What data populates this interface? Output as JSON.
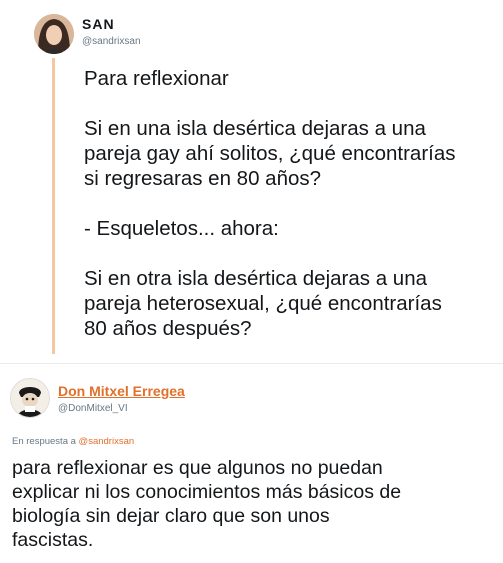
{
  "tweet": {
    "display_name": "SAN",
    "handle": "@sandrixsan",
    "lines": [
      "Para reflexionar",
      "",
      "Si en una isla desértica dejaras a una",
      "pareja gay ahí solitos, ¿qué encontrarías",
      "si regresaras en 80 años?",
      "",
      "- Esqueletos... ahora:",
      "",
      "Si en otra isla desértica dejaras a una",
      "pareja heterosexual, ¿qué encontrarías",
      "80 años después?"
    ]
  },
  "reply": {
    "display_name": "Don Mitxel Erregea",
    "handle": "@DonMitxel_VI",
    "reply_prefix": "En respuesta a",
    "reply_to_handle": "@sandrixsan",
    "lines": [
      "para reflexionar es que algunos no puedan",
      "explicar ni los conocimientos más básicos de",
      "biología sin dejar claro que son unos",
      "fascistas."
    ]
  },
  "colors": {
    "accent": "#e0702a",
    "thread_line": "#f2c8a0",
    "secondary_text": "#657786",
    "primary_text": "#14171a"
  }
}
